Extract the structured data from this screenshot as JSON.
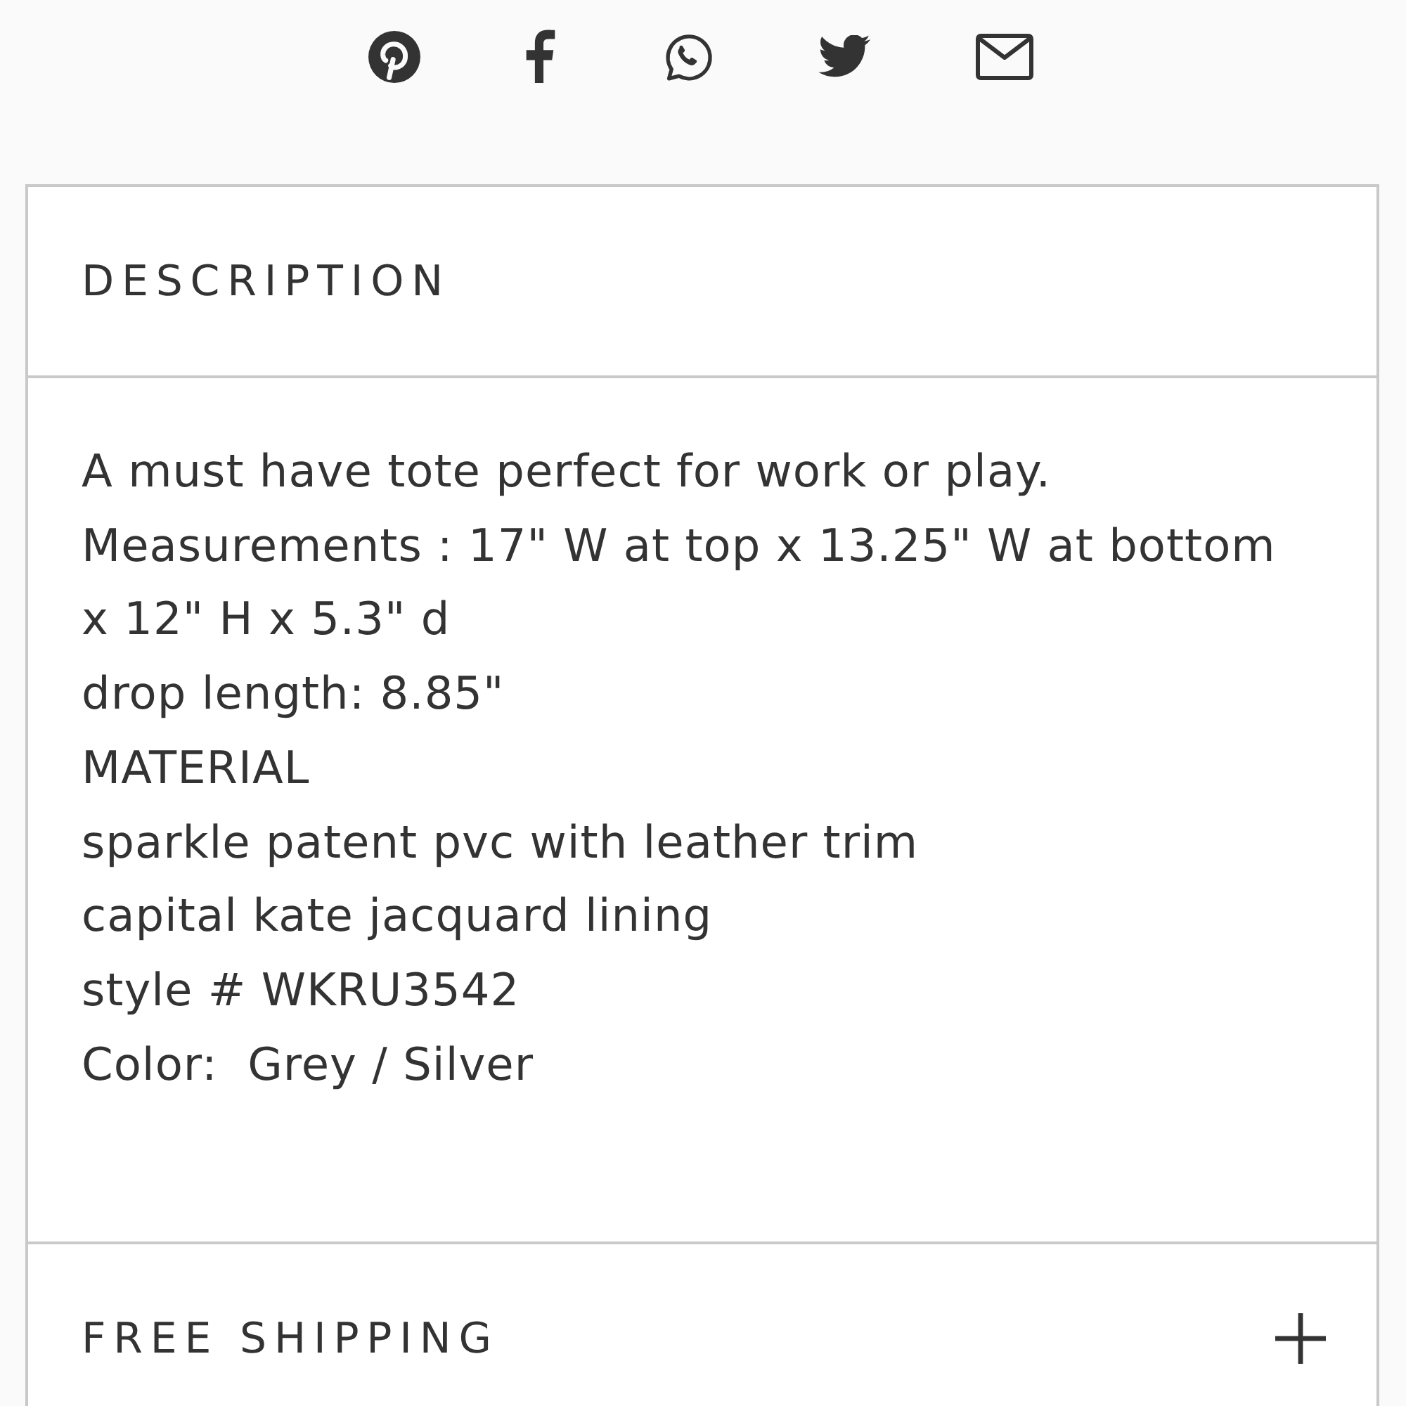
{
  "sections": [
    {
      "title": "DESCRIPTION",
      "expanded": true,
      "lines": [
        "A must have tote perfect for work or play.",
        "Measurements : 17\" W at top x 13.25\" W at bottom",
        "x 12\" H x 5.3\" d",
        "drop length: 8.85\"",
        "MATERIAL",
        "sparkle patent pvc with leather trim",
        "capital kate jacquard lining",
        "style # WKRU3542",
        "Color:  Grey / Silver"
      ]
    },
    {
      "title": "FREE SHIPPING",
      "expanded": false
    }
  ]
}
